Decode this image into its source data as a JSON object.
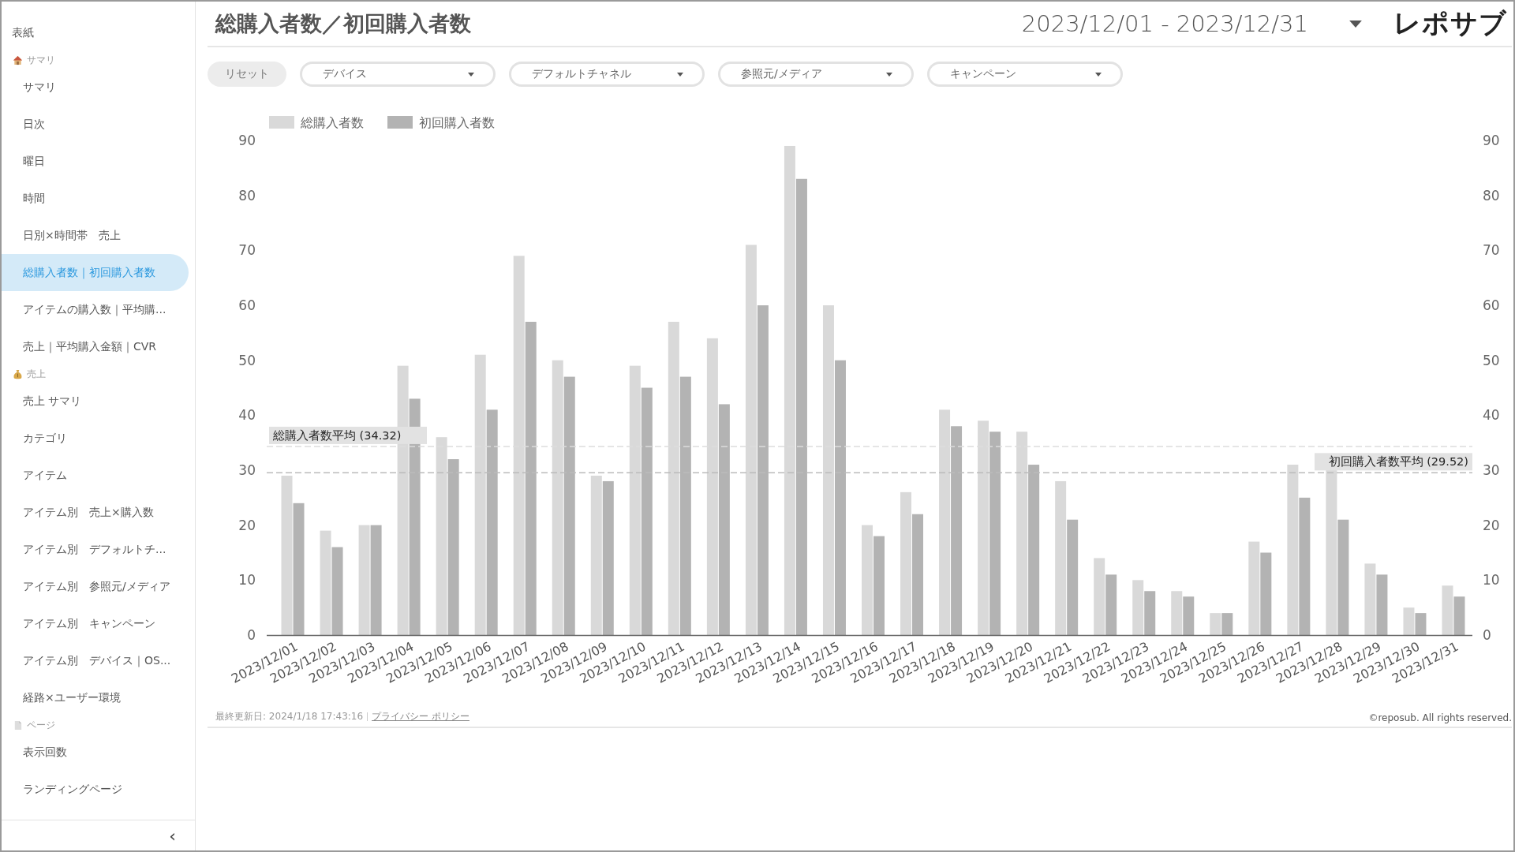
{
  "sidebar": {
    "items": [
      {
        "kind": "top",
        "label": "表紙",
        "selected": false
      },
      {
        "kind": "section",
        "label": "サマリ"
      },
      {
        "kind": "link",
        "label": "サマリ",
        "selected": false
      },
      {
        "kind": "link",
        "label": "日次",
        "selected": false
      },
      {
        "kind": "link",
        "label": "曜日",
        "selected": false
      },
      {
        "kind": "link",
        "label": "時間",
        "selected": false
      },
      {
        "kind": "link",
        "label": "日別×時間帯　売上",
        "selected": false
      },
      {
        "kind": "link",
        "label": "総購入者数｜初回購入者数",
        "selected": true
      },
      {
        "kind": "link",
        "label": "アイテムの購入数｜平均購...",
        "selected": false
      },
      {
        "kind": "link",
        "label": "売上｜平均購入金額｜CVR",
        "selected": false
      },
      {
        "kind": "section",
        "label": "売上"
      },
      {
        "kind": "link",
        "label": "売上 サマリ",
        "selected": false
      },
      {
        "kind": "link",
        "label": "カテゴリ",
        "selected": false
      },
      {
        "kind": "link",
        "label": "アイテム",
        "selected": false
      },
      {
        "kind": "link",
        "label": "アイテム別　売上×購入数",
        "selected": false
      },
      {
        "kind": "link",
        "label": "アイテム別　デフォルトチ...",
        "selected": false
      },
      {
        "kind": "link",
        "label": "アイテム別　参照元/メディア",
        "selected": false
      },
      {
        "kind": "link",
        "label": "アイテム別　キャンペーン",
        "selected": false
      },
      {
        "kind": "link",
        "label": "アイテム別　デバイス｜OS...",
        "selected": false
      },
      {
        "kind": "link",
        "label": "経路×ユーザー環境",
        "selected": false
      },
      {
        "kind": "section",
        "label": "ページ"
      },
      {
        "kind": "link",
        "label": "表示回数",
        "selected": false
      },
      {
        "kind": "link",
        "label": "ランディングページ",
        "selected": false
      }
    ],
    "collapse": "‹"
  },
  "header": {
    "title": "総購入者数／初回購入者数",
    "date_range": "2023/12/01 - 2023/12/31",
    "logo": "レポサブ"
  },
  "filters": {
    "reset": "リセット",
    "dropdowns": [
      "デバイス",
      "デフォルトチャネル",
      "参照元/メディア",
      "キャンペーン"
    ]
  },
  "chart": {
    "chart_data": {
      "type": "bar",
      "categories": [
        "2023/12/01",
        "2023/12/02",
        "2023/12/03",
        "2023/12/04",
        "2023/12/05",
        "2023/12/06",
        "2023/12/07",
        "2023/12/08",
        "2023/12/09",
        "2023/12/10",
        "2023/12/11",
        "2023/12/12",
        "2023/12/13",
        "2023/12/14",
        "2023/12/15",
        "2023/12/16",
        "2023/12/17",
        "2023/12/18",
        "2023/12/19",
        "2023/12/20",
        "2023/12/21",
        "2023/12/22",
        "2023/12/23",
        "2023/12/24",
        "2023/12/25",
        "2023/12/26",
        "2023/12/27",
        "2023/12/28",
        "2023/12/29",
        "2023/12/30",
        "2023/12/31"
      ],
      "series": [
        {
          "name": "総購入者数",
          "color": "#d9d9d9",
          "values": [
            29,
            19,
            20,
            49,
            36,
            51,
            69,
            50,
            29,
            49,
            57,
            54,
            71,
            89,
            60,
            20,
            26,
            41,
            39,
            37,
            28,
            14,
            10,
            8,
            4,
            17,
            31,
            30,
            13,
            5,
            9
          ]
        },
        {
          "name": "初回購入者数",
          "color": "#b3b3b3",
          "values": [
            24,
            16,
            20,
            43,
            32,
            41,
            57,
            47,
            28,
            45,
            47,
            42,
            60,
            83,
            50,
            18,
            22,
            38,
            37,
            31,
            21,
            11,
            8,
            7,
            4,
            15,
            25,
            21,
            11,
            4,
            7
          ]
        }
      ],
      "ylim": [
        0,
        90
      ],
      "yticks": [
        0,
        10,
        20,
        30,
        40,
        50,
        60,
        70,
        80,
        90
      ],
      "y2ticks": [
        0,
        10,
        20,
        30,
        40,
        50,
        60,
        70,
        80,
        90
      ],
      "y2lim": [
        0,
        90
      ],
      "legend": "top-left",
      "ref_lines": [
        {
          "axis": "y",
          "value": 34.32,
          "label": "総購入者数平均 (34.32)"
        },
        {
          "axis": "y",
          "value": 29.52,
          "label": "初回購入者数平均 (29.52)"
        }
      ]
    }
  },
  "footer": {
    "updated": "最終更新日: 2024/1/18 17:43:16",
    "privacy_link": "プライバシー ポリシー",
    "copyright": "©reposub. All rights reserved."
  }
}
